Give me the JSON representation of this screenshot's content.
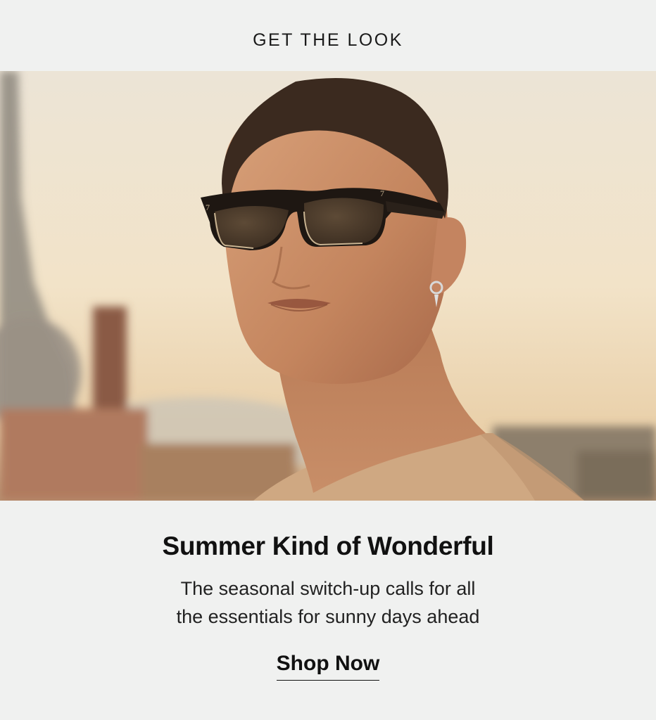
{
  "header": {
    "title": "GET THE LOOK"
  },
  "hero": {
    "image_subject": "man-wearing-dark-half-rim-sunglasses",
    "palette": {
      "sky": "#f1e2c9",
      "skin": "#c88c66",
      "hair": "#3b2a1f",
      "lens": "#4a3a2a",
      "shirt": "#cfa882",
      "building": "#8a7a6e"
    }
  },
  "promo": {
    "headline": "Summer Kind of Wonderful",
    "body_line_1": "The seasonal switch-up calls for all",
    "body_line_2": "the essentials for sunny days ahead",
    "cta_label": "Shop Now"
  }
}
